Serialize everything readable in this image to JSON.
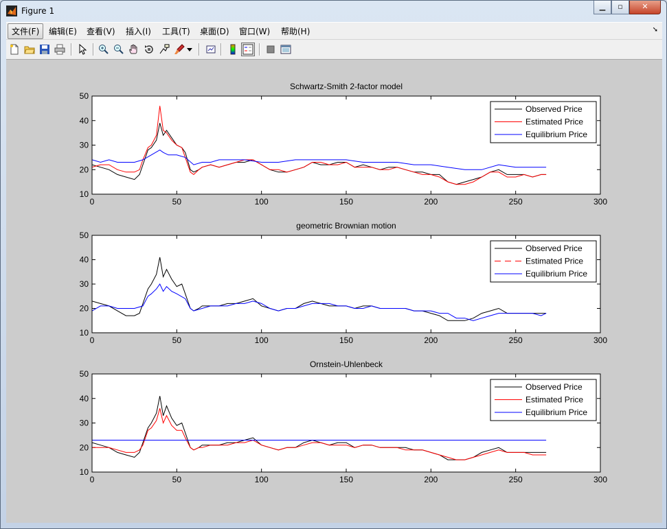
{
  "window": {
    "title": "Figure 1"
  },
  "menu": [
    {
      "label": "文件(F)",
      "active": true
    },
    {
      "label": "编辑(E)"
    },
    {
      "label": "查看(V)"
    },
    {
      "label": "插入(I)"
    },
    {
      "label": "工具(T)"
    },
    {
      "label": "桌面(D)"
    },
    {
      "label": "窗口(W)"
    },
    {
      "label": "帮助(H)"
    }
  ],
  "toolbar": [
    "new-figure-icon",
    "open-file-icon",
    "save-icon",
    "print-icon",
    "edit-plot-arrow-icon",
    "zoom-in-icon",
    "zoom-out-icon",
    "pan-hand-icon",
    "rotate-3d-icon",
    "data-cursor-icon",
    "brush-icon",
    "brush-dropdown-icon",
    "link-plot-icon",
    "insert-colorbar-icon",
    "insert-legend-icon",
    "hide-plot-tools-icon",
    "show-plot-tools-icon"
  ],
  "colors": {
    "observed": "#000000",
    "estimated": "#ff0000",
    "equilibrium": "#0000ff",
    "figure_bg": "#cccccc",
    "axes_bg": "#ffffff"
  },
  "chart_data": [
    {
      "type": "line",
      "title": "Schwartz-Smith 2-factor model",
      "xlim": [
        0,
        300
      ],
      "ylim": [
        10,
        50
      ],
      "xticks": [
        0,
        50,
        100,
        150,
        200,
        250,
        300
      ],
      "yticks": [
        10,
        20,
        30,
        40,
        50
      ],
      "legend": {
        "position": "top-right",
        "entries": [
          "Observed Price",
          "Estimated Price",
          "Equilibrium Price"
        ]
      },
      "series": [
        {
          "name": "Observed Price",
          "color": "#000000",
          "x": [
            0,
            5,
            10,
            15,
            20,
            25,
            28,
            30,
            33,
            35,
            38,
            40,
            42,
            44,
            47,
            50,
            53,
            55,
            58,
            60,
            63,
            65,
            70,
            75,
            80,
            85,
            90,
            95,
            100,
            105,
            110,
            115,
            120,
            125,
            130,
            135,
            140,
            145,
            150,
            155,
            160,
            165,
            170,
            175,
            180,
            185,
            190,
            195,
            200,
            205,
            210,
            215,
            220,
            225,
            230,
            235,
            240,
            245,
            250,
            255,
            260,
            265,
            268
          ],
          "y": [
            22,
            21,
            20,
            18,
            17,
            16,
            18,
            22,
            28,
            29,
            32,
            39,
            34,
            36,
            33,
            30,
            29,
            27,
            20,
            19,
            20,
            21,
            22,
            21,
            22,
            23,
            23,
            24,
            22,
            20,
            19,
            19,
            20,
            21,
            23,
            22,
            22,
            23,
            23,
            21,
            22,
            21,
            20,
            21,
            21,
            20,
            19,
            19,
            18,
            18,
            15,
            14,
            15,
            16,
            17,
            19,
            20,
            18,
            18,
            18,
            17,
            18,
            18
          ]
        },
        {
          "name": "Estimated Price",
          "color": "#ff0000",
          "x": [
            0,
            5,
            10,
            15,
            20,
            25,
            28,
            30,
            33,
            35,
            38,
            40,
            42,
            44,
            47,
            50,
            53,
            55,
            58,
            60,
            63,
            65,
            70,
            75,
            80,
            85,
            90,
            95,
            100,
            105,
            110,
            115,
            120,
            125,
            130,
            135,
            140,
            145,
            150,
            155,
            160,
            165,
            170,
            175,
            180,
            185,
            190,
            195,
            200,
            205,
            210,
            215,
            220,
            225,
            230,
            235,
            240,
            245,
            250,
            255,
            260,
            265,
            268
          ],
          "y": [
            21,
            22,
            22,
            20,
            19,
            19,
            20,
            24,
            29,
            30,
            34,
            46,
            36,
            35,
            32,
            30,
            29,
            25,
            19,
            18,
            20,
            21,
            22,
            21,
            22,
            23,
            24,
            24,
            22,
            20,
            20,
            19,
            20,
            21,
            23,
            23,
            22,
            22,
            23,
            21,
            21,
            21,
            20,
            20,
            21,
            20,
            19,
            18,
            18,
            17,
            15,
            14,
            14,
            15,
            17,
            19,
            19,
            17,
            17,
            18,
            17,
            18,
            18
          ]
        },
        {
          "name": "Equilibrium Price",
          "color": "#0000ff",
          "x": [
            0,
            5,
            10,
            15,
            20,
            25,
            30,
            35,
            40,
            42,
            45,
            50,
            55,
            60,
            65,
            70,
            75,
            80,
            90,
            100,
            110,
            120,
            130,
            140,
            150,
            160,
            170,
            180,
            190,
            200,
            210,
            220,
            230,
            240,
            250,
            260,
            268
          ],
          "y": [
            24,
            23,
            24,
            23,
            23,
            23,
            24,
            26,
            28,
            27,
            26,
            26,
            25,
            22,
            23,
            23,
            24,
            24,
            24,
            23,
            23,
            24,
            24,
            24,
            24,
            23,
            23,
            23,
            22,
            22,
            21,
            20,
            20,
            22,
            21,
            21,
            21
          ]
        }
      ]
    },
    {
      "type": "line",
      "title": "geometric Brownian motion",
      "xlim": [
        0,
        300
      ],
      "ylim": [
        10,
        50
      ],
      "xticks": [
        0,
        50,
        100,
        150,
        200,
        250,
        300
      ],
      "yticks": [
        10,
        20,
        30,
        40,
        50
      ],
      "legend": {
        "position": "top-right",
        "entries": [
          "Observed Price",
          "Estimated Price",
          "Equilibrium Price"
        ]
      },
      "series": [
        {
          "name": "Observed Price",
          "color": "#000000",
          "x": [
            0,
            5,
            10,
            15,
            20,
            25,
            28,
            30,
            33,
            35,
            38,
            40,
            42,
            44,
            47,
            50,
            53,
            55,
            58,
            60,
            63,
            65,
            70,
            75,
            80,
            85,
            90,
            95,
            100,
            105,
            110,
            115,
            120,
            125,
            130,
            135,
            140,
            145,
            150,
            155,
            160,
            165,
            170,
            175,
            180,
            185,
            190,
            195,
            200,
            205,
            210,
            215,
            220,
            225,
            230,
            235,
            240,
            245,
            250,
            255,
            260,
            265,
            268
          ],
          "y": [
            23,
            22,
            21,
            19,
            17,
            17,
            18,
            22,
            28,
            30,
            34,
            41,
            33,
            36,
            32,
            29,
            30,
            26,
            20,
            19,
            20,
            21,
            21,
            21,
            22,
            22,
            23,
            24,
            21,
            20,
            19,
            20,
            20,
            22,
            23,
            22,
            21,
            21,
            21,
            20,
            21,
            21,
            20,
            20,
            20,
            20,
            19,
            19,
            18,
            17,
            15,
            15,
            15,
            16,
            18,
            19,
            20,
            18,
            18,
            18,
            18,
            18,
            18
          ]
        },
        {
          "name": "Estimated Price",
          "color": "#ff0000",
          "dashed": true,
          "x": [
            0,
            10,
            20,
            30,
            40,
            50,
            60,
            80,
            100,
            120,
            140,
            160,
            180,
            200,
            220,
            240,
            260,
            268
          ],
          "y": [
            20,
            20,
            20,
            21,
            28,
            25,
            20,
            21,
            22,
            20,
            21,
            20,
            20,
            19,
            16,
            18,
            18,
            18
          ]
        },
        {
          "name": "Equilibrium Price",
          "color": "#0000ff",
          "x": [
            0,
            5,
            10,
            15,
            20,
            25,
            30,
            33,
            35,
            38,
            40,
            42,
            44,
            47,
            50,
            55,
            58,
            60,
            65,
            70,
            75,
            80,
            85,
            90,
            95,
            100,
            105,
            110,
            115,
            120,
            125,
            130,
            135,
            140,
            145,
            150,
            155,
            160,
            165,
            170,
            175,
            180,
            185,
            190,
            195,
            200,
            205,
            210,
            215,
            220,
            225,
            230,
            235,
            240,
            245,
            250,
            255,
            260,
            265,
            268
          ],
          "y": [
            19,
            21,
            21,
            20,
            20,
            20,
            21,
            25,
            26,
            28,
            30,
            27,
            29,
            27,
            26,
            24,
            20,
            19,
            20,
            21,
            21,
            21,
            22,
            22,
            23,
            22,
            20,
            19,
            20,
            20,
            21,
            22,
            22,
            22,
            21,
            21,
            20,
            20,
            21,
            20,
            20,
            20,
            20,
            19,
            19,
            19,
            18,
            18,
            16,
            16,
            15,
            16,
            17,
            18,
            18,
            18,
            18,
            18,
            17,
            18
          ]
        }
      ]
    },
    {
      "type": "line",
      "title": "Ornstein-Uhlenbeck",
      "xlim": [
        0,
        300
      ],
      "ylim": [
        10,
        50
      ],
      "xticks": [
        0,
        50,
        100,
        150,
        200,
        250,
        300
      ],
      "yticks": [
        10,
        20,
        30,
        40,
        50
      ],
      "legend": {
        "position": "top-right",
        "entries": [
          "Observed Price",
          "Estimated Price",
          "Equilibrium Price"
        ]
      },
      "series": [
        {
          "name": "Observed Price",
          "color": "#000000",
          "x": [
            0,
            5,
            10,
            15,
            20,
            25,
            28,
            30,
            33,
            35,
            38,
            40,
            42,
            44,
            47,
            50,
            53,
            55,
            58,
            60,
            63,
            65,
            70,
            75,
            80,
            85,
            90,
            95,
            100,
            105,
            110,
            115,
            120,
            125,
            130,
            135,
            140,
            145,
            150,
            155,
            160,
            165,
            170,
            175,
            180,
            185,
            190,
            195,
            200,
            205,
            210,
            215,
            220,
            225,
            230,
            235,
            240,
            245,
            250,
            255,
            260,
            265,
            268
          ],
          "y": [
            22,
            21,
            20,
            18,
            17,
            16,
            18,
            22,
            28,
            30,
            34,
            41,
            33,
            37,
            32,
            29,
            30,
            26,
            20,
            19,
            20,
            21,
            21,
            21,
            22,
            22,
            23,
            24,
            21,
            20,
            19,
            20,
            20,
            22,
            23,
            22,
            21,
            22,
            22,
            20,
            21,
            21,
            20,
            20,
            20,
            20,
            19,
            19,
            18,
            17,
            15,
            15,
            15,
            16,
            18,
            19,
            20,
            18,
            18,
            18,
            18,
            18,
            18
          ]
        },
        {
          "name": "Estimated Price",
          "color": "#ff0000",
          "x": [
            0,
            5,
            10,
            15,
            20,
            25,
            28,
            30,
            33,
            35,
            38,
            40,
            42,
            44,
            47,
            50,
            53,
            55,
            58,
            60,
            63,
            65,
            70,
            75,
            80,
            85,
            90,
            95,
            100,
            105,
            110,
            115,
            120,
            125,
            130,
            135,
            140,
            145,
            150,
            155,
            160,
            165,
            170,
            175,
            180,
            185,
            190,
            195,
            200,
            205,
            210,
            215,
            220,
            225,
            230,
            235,
            240,
            245,
            250,
            255,
            260,
            265,
            268
          ],
          "y": [
            20,
            20,
            20,
            19,
            18,
            18,
            19,
            21,
            27,
            28,
            31,
            36,
            30,
            33,
            29,
            27,
            27,
            24,
            20,
            19,
            20,
            20,
            21,
            21,
            21,
            22,
            22,
            23,
            21,
            20,
            19,
            20,
            20,
            21,
            22,
            22,
            21,
            21,
            21,
            20,
            21,
            21,
            20,
            20,
            20,
            19,
            19,
            19,
            18,
            17,
            16,
            15,
            15,
            16,
            17,
            18,
            19,
            18,
            18,
            18,
            17,
            17,
            17
          ]
        },
        {
          "name": "Equilibrium Price",
          "color": "#0000ff",
          "x": [
            0,
            268
          ],
          "y": [
            23,
            23
          ]
        }
      ]
    }
  ]
}
